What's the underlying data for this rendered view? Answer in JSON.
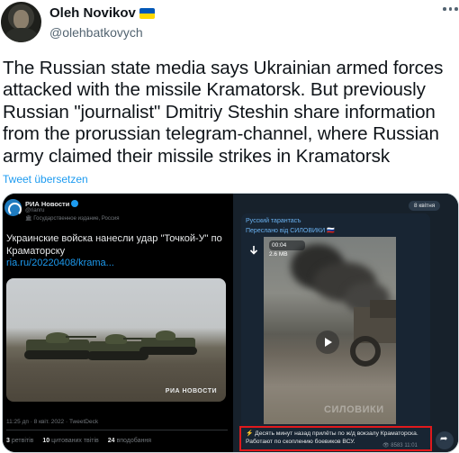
{
  "author": {
    "name": "Oleh Novikov",
    "handle": "@olehbatkovych",
    "flag_colors": [
      "#0057b7",
      "#ffd700"
    ]
  },
  "tweet": {
    "text": "The Russian state media says Ukrainian armed forces attacked with the missile Kramatorsk. But previously Russian \"journalist\" Dmitriy Steshin share information from the prorussian telegram-channel, where Russian army claimed their missile strikes in Kramatorsk",
    "translate_label": "Tweet übersetzen"
  },
  "ria": {
    "name": "РИА Новости",
    "handle": "@rianru",
    "gov_label": "Государственное издание, Россия",
    "headline": "Украинские войска нанесли удар \"Точкой-У\" по Краматорску",
    "link": "ria.ru/20220408/krama...",
    "watermark": "РИА НОВОСТИ",
    "datetime": "11:25 дп · 8 квіт. 2022 · TweetDeck",
    "stats": [
      {
        "value": "3",
        "label": "ретвітів"
      },
      {
        "value": "10",
        "label": "цитованих твітів"
      },
      {
        "value": "24",
        "label": "вподобання"
      }
    ]
  },
  "telegram": {
    "date_badge": "8 квітня",
    "channel": "Русский тарантасъ",
    "forwarded": "Переслано від СИЛОВИКИ 🇷🇺",
    "video_time": "00:04",
    "video_size": "2.6 MB",
    "watermark": "СИЛОВИКИ",
    "caption": "⚡ Десять минут назад прилёты по ж/д вокзалу Краматорска. Работают по скоплению боевиков ВСУ.",
    "views": "👁 8583",
    "time": "11:01",
    "highlight_color": "#e0191c"
  }
}
